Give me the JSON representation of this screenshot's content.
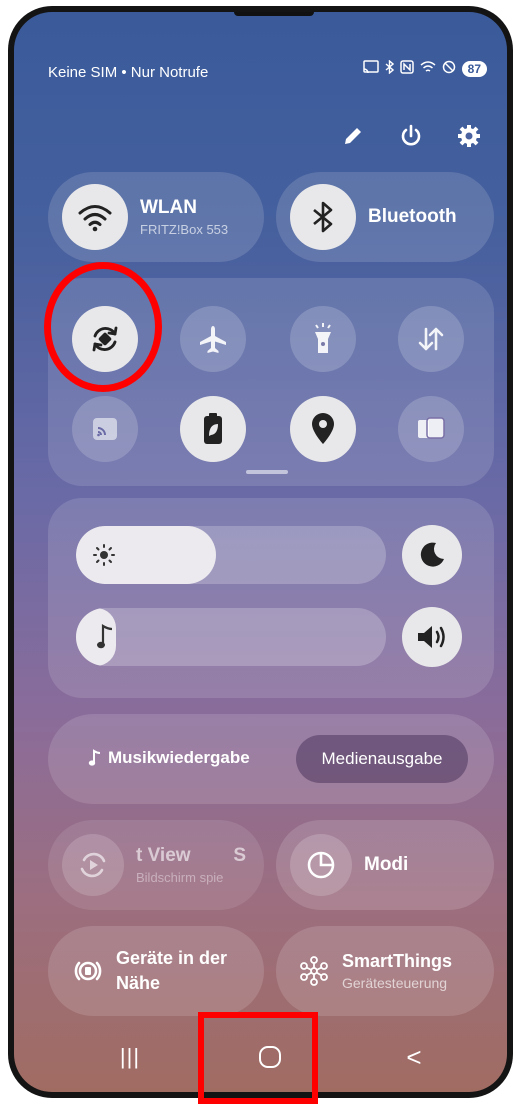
{
  "status_bar": {
    "carrier": "Keine SIM • Nur Notrufe",
    "battery": "87"
  },
  "toolbar": {
    "icons": [
      "pencil-icon",
      "power-icon",
      "gear-icon"
    ]
  },
  "tiles": {
    "wifi": {
      "title": "WLAN",
      "subtitle": "FRITZ!Box 553",
      "state": "on"
    },
    "bluetooth": {
      "title": "Bluetooth",
      "state": "on"
    }
  },
  "quick_icons": {
    "row1": [
      {
        "name": "auto-rotate-icon",
        "state": "on"
      },
      {
        "name": "airplane-icon",
        "state": "off"
      },
      {
        "name": "flashlight-icon",
        "state": "off"
      },
      {
        "name": "mobile-data-icon",
        "state": "off"
      }
    ],
    "row2": [
      {
        "name": "cast-icon",
        "state": "off"
      },
      {
        "name": "power-saving-icon",
        "state": "on"
      },
      {
        "name": "location-icon",
        "state": "on"
      },
      {
        "name": "device-link-icon",
        "state": "off"
      }
    ]
  },
  "sliders": {
    "brightness": 0.45,
    "volume": 0.07
  },
  "media": {
    "label": "Musikwiedergabe",
    "output_button": "Medienausgabe"
  },
  "bottom_tiles": {
    "smart_view": {
      "title": "t View",
      "title_extra": "S",
      "subtitle": "Bildschirm spie"
    },
    "modes": {
      "title": "Modi"
    },
    "nearby": {
      "title_line1": "Geräte in der",
      "title_line2": "Nähe"
    },
    "smartthings": {
      "title": "SmartThings",
      "subtitle": "Gerätesteuerung"
    }
  },
  "navbar": {
    "recent_glyph": "|||",
    "back_glyph": "<"
  },
  "colors": {
    "highlight": "#ff0000",
    "tile_on": "#e8e8ea"
  }
}
